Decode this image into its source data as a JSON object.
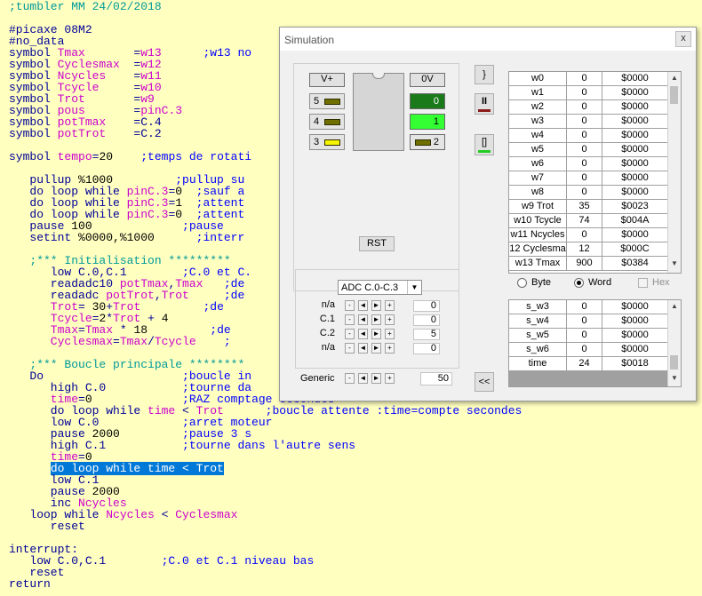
{
  "code_lines": [
    [
      {
        "c": "gr",
        "t": ";tumbler MM 24/02/2018"
      }
    ],
    [],
    [
      {
        "c": "kw",
        "t": "#picaxe 08M2"
      }
    ],
    [
      {
        "c": "kw",
        "t": "#no_data"
      }
    ],
    [
      {
        "c": "kw",
        "t": "symbol "
      },
      {
        "c": "vr",
        "t": "Tmax"
      },
      {
        "c": "kw",
        "t": "       ="
      },
      {
        "c": "vr",
        "t": "w13"
      },
      {
        "c": "cm",
        "t": "      ;w13 no"
      }
    ],
    [
      {
        "c": "kw",
        "t": "symbol "
      },
      {
        "c": "vr",
        "t": "Cyclesmax"
      },
      {
        "c": "kw",
        "t": "  ="
      },
      {
        "c": "vr",
        "t": "w12"
      }
    ],
    [
      {
        "c": "kw",
        "t": "symbol "
      },
      {
        "c": "vr",
        "t": "Ncycles"
      },
      {
        "c": "kw",
        "t": "    ="
      },
      {
        "c": "vr",
        "t": "w11"
      }
    ],
    [
      {
        "c": "kw",
        "t": "symbol "
      },
      {
        "c": "vr",
        "t": "Tcycle"
      },
      {
        "c": "kw",
        "t": "     ="
      },
      {
        "c": "vr",
        "t": "w10"
      }
    ],
    [
      {
        "c": "kw",
        "t": "symbol "
      },
      {
        "c": "vr",
        "t": "Trot"
      },
      {
        "c": "kw",
        "t": "       ="
      },
      {
        "c": "vr",
        "t": "w9"
      }
    ],
    [
      {
        "c": "kw",
        "t": "symbol "
      },
      {
        "c": "vr",
        "t": "pous"
      },
      {
        "c": "kw",
        "t": "       ="
      },
      {
        "c": "vr",
        "t": "pinC.3"
      }
    ],
    [
      {
        "c": "kw",
        "t": "symbol "
      },
      {
        "c": "vr",
        "t": "potTmax"
      },
      {
        "c": "kw",
        "t": "    =C.4"
      }
    ],
    [
      {
        "c": "kw",
        "t": "symbol "
      },
      {
        "c": "vr",
        "t": "potTrot"
      },
      {
        "c": "kw",
        "t": "    =C.2"
      }
    ],
    [],
    [
      {
        "c": "kw",
        "t": "symbol "
      },
      {
        "c": "vr",
        "t": "tempo"
      },
      {
        "c": "kw",
        "t": "="
      },
      {
        "c": "nm",
        "t": "20"
      },
      {
        "c": "cm",
        "t": "    ;temps de rotati"
      }
    ],
    [],
    [
      {
        "c": "kw",
        "t": "   pullup "
      },
      {
        "c": "nm",
        "t": "%1000"
      },
      {
        "c": "cm",
        "t": "         ;pullup su"
      }
    ],
    [
      {
        "c": "kw",
        "t": "   do loop while "
      },
      {
        "c": "vr",
        "t": "pinC.3"
      },
      {
        "c": "kw",
        "t": "="
      },
      {
        "c": "nm",
        "t": "0"
      },
      {
        "c": "cm",
        "t": "  ;sauf a"
      }
    ],
    [
      {
        "c": "kw",
        "t": "   do loop while "
      },
      {
        "c": "vr",
        "t": "pinC.3"
      },
      {
        "c": "kw",
        "t": "="
      },
      {
        "c": "nm",
        "t": "1"
      },
      {
        "c": "cm",
        "t": "  ;attent"
      }
    ],
    [
      {
        "c": "kw",
        "t": "   do loop while "
      },
      {
        "c": "vr",
        "t": "pinC.3"
      },
      {
        "c": "kw",
        "t": "="
      },
      {
        "c": "nm",
        "t": "0"
      },
      {
        "c": "cm",
        "t": "  ;attent"
      }
    ],
    [
      {
        "c": "kw",
        "t": "   pause "
      },
      {
        "c": "nm",
        "t": "100"
      },
      {
        "c": "cm",
        "t": "             ;pause"
      }
    ],
    [
      {
        "c": "kw",
        "t": "   setint "
      },
      {
        "c": "nm",
        "t": "%0000,%1000"
      },
      {
        "c": "cm",
        "t": "      ;interr"
      }
    ],
    [],
    [
      {
        "c": "gr",
        "t": "   ;*** Initialisation *********"
      }
    ],
    [
      {
        "c": "kw",
        "t": "      low C.0,C.1"
      },
      {
        "c": "cm",
        "t": "        ;C.0 et C."
      }
    ],
    [
      {
        "c": "kw",
        "t": "      readadc10 "
      },
      {
        "c": "vr",
        "t": "potTmax"
      },
      {
        "c": "kw",
        "t": ","
      },
      {
        "c": "vr",
        "t": "Tmax"
      },
      {
        "c": "cm",
        "t": "   ;de"
      }
    ],
    [
      {
        "c": "kw",
        "t": "      readadc "
      },
      {
        "c": "vr",
        "t": "potTrot"
      },
      {
        "c": "kw",
        "t": ","
      },
      {
        "c": "vr",
        "t": "Trot"
      },
      {
        "c": "cm",
        "t": "     ;de"
      }
    ],
    [
      {
        "c": "vr",
        "t": "      Trot"
      },
      {
        "c": "kw",
        "t": "= "
      },
      {
        "c": "nm",
        "t": "30"
      },
      {
        "c": "kw",
        "t": "+"
      },
      {
        "c": "vr",
        "t": "Trot"
      },
      {
        "c": "cm",
        "t": "         ;de"
      }
    ],
    [
      {
        "c": "vr",
        "t": "      Tcycle"
      },
      {
        "c": "kw",
        "t": "="
      },
      {
        "c": "nm",
        "t": "2"
      },
      {
        "c": "kw",
        "t": "*"
      },
      {
        "c": "vr",
        "t": "Trot"
      },
      {
        "c": "kw",
        "t": " + "
      },
      {
        "c": "nm",
        "t": "4"
      }
    ],
    [
      {
        "c": "vr",
        "t": "      Tmax"
      },
      {
        "c": "kw",
        "t": "="
      },
      {
        "c": "vr",
        "t": "Tmax"
      },
      {
        "c": "kw",
        "t": " * "
      },
      {
        "c": "nm",
        "t": "18"
      },
      {
        "c": "cm",
        "t": "         ;de"
      }
    ],
    [
      {
        "c": "vr",
        "t": "      Cyclesmax"
      },
      {
        "c": "kw",
        "t": "="
      },
      {
        "c": "vr",
        "t": "Tmax"
      },
      {
        "c": "kw",
        "t": "/"
      },
      {
        "c": "vr",
        "t": "Tcycle"
      },
      {
        "c": "cm",
        "t": "    ;"
      }
    ],
    [],
    [
      {
        "c": "gr",
        "t": "   ;*** Boucle principale ********"
      }
    ],
    [
      {
        "c": "kw",
        "t": "   Do"
      },
      {
        "c": "cm",
        "t": "                    ;boucle in"
      }
    ],
    [
      {
        "c": "kw",
        "t": "      high C.0"
      },
      {
        "c": "cm",
        "t": "           ;tourne da"
      }
    ],
    [
      {
        "c": "vr",
        "t": "      time"
      },
      {
        "c": "kw",
        "t": "="
      },
      {
        "c": "nm",
        "t": "0"
      },
      {
        "c": "cm",
        "t": "             ;RAZ comptage secondes"
      }
    ],
    [
      {
        "c": "kw",
        "t": "      do loop while "
      },
      {
        "c": "vr",
        "t": "time"
      },
      {
        "c": "kw",
        "t": " < "
      },
      {
        "c": "vr",
        "t": "Trot"
      },
      {
        "c": "cm",
        "t": "      ;boucle attente :time=compte secondes"
      }
    ],
    [
      {
        "c": "kw",
        "t": "      low C.0"
      },
      {
        "c": "cm",
        "t": "            ;arret moteur"
      }
    ],
    [
      {
        "c": "kw",
        "t": "      pause "
      },
      {
        "c": "nm",
        "t": "2000"
      },
      {
        "c": "cm",
        "t": "         ;pause 3 s"
      }
    ],
    [
      {
        "c": "kw",
        "t": "      high C.1"
      },
      {
        "c": "cm",
        "t": "           ;tourne dans l'autre sens"
      }
    ],
    [
      {
        "c": "vr",
        "t": "      time"
      },
      {
        "c": "kw",
        "t": "="
      },
      {
        "c": "nm",
        "t": "0"
      }
    ],
    [
      {
        "c": "kw",
        "t": "      "
      },
      {
        "c": "sel",
        "t": "do loop while time < Trot"
      }
    ],
    [
      {
        "c": "kw",
        "t": "      low C.1"
      }
    ],
    [
      {
        "c": "kw",
        "t": "      pause "
      },
      {
        "c": "nm",
        "t": "2000"
      }
    ],
    [
      {
        "c": "kw",
        "t": "      inc "
      },
      {
        "c": "vr",
        "t": "Ncycles"
      }
    ],
    [
      {
        "c": "kw",
        "t": "   loop while "
      },
      {
        "c": "vr",
        "t": "Ncycles"
      },
      {
        "c": "kw",
        "t": " < "
      },
      {
        "c": "vr",
        "t": "Cyclesmax"
      }
    ],
    [
      {
        "c": "kw",
        "t": "      reset"
      }
    ],
    [],
    [
      {
        "c": "kw",
        "t": "interrupt:"
      }
    ],
    [
      {
        "c": "kw",
        "t": "   low C.0,C.1"
      },
      {
        "c": "cm",
        "t": "        ;C.0 et C.1 niveau bas"
      }
    ],
    [
      {
        "c": "kw",
        "t": "   reset"
      }
    ],
    [
      {
        "c": "kw",
        "t": "return"
      }
    ]
  ],
  "sim": {
    "title": "Simulation",
    "close": "x",
    "vplus": "V+",
    "zerov": "0V",
    "pins_left": [
      {
        "label": "5",
        "led": "off"
      },
      {
        "label": "4",
        "led": "off"
      },
      {
        "label": "3",
        "led": "on"
      }
    ],
    "pins_right": [
      {
        "label": "0",
        "color": "#1a7a1a"
      },
      {
        "label": "1",
        "color": "#33ff33"
      },
      {
        "label": "2",
        "color": "#e4e4e4"
      }
    ],
    "rst": "RST",
    "adc_select": "ADC C.0-C.3",
    "adc_rows": [
      {
        "label": "n/a",
        "value": "0"
      },
      {
        "label": "C.1",
        "value": "0"
      },
      {
        "label": "C.2",
        "value": "5"
      },
      {
        "label": "n/a",
        "value": "0"
      }
    ],
    "generic_label": "Generic",
    "generic_value": "50",
    "ctrl": {
      "step": "}",
      "pause": "II",
      "stop": "[]",
      "back": "<<"
    },
    "vars": [
      {
        "n": "w0",
        "d": "0",
        "h": "$0000"
      },
      {
        "n": "w1",
        "d": "0",
        "h": "$0000"
      },
      {
        "n": "w2",
        "d": "0",
        "h": "$0000"
      },
      {
        "n": "w3",
        "d": "0",
        "h": "$0000"
      },
      {
        "n": "w4",
        "d": "0",
        "h": "$0000"
      },
      {
        "n": "w5",
        "d": "0",
        "h": "$0000"
      },
      {
        "n": "w6",
        "d": "0",
        "h": "$0000"
      },
      {
        "n": "w7",
        "d": "0",
        "h": "$0000"
      },
      {
        "n": "w8",
        "d": "0",
        "h": "$0000"
      },
      {
        "n": "w9 Trot",
        "d": "35",
        "h": "$0023"
      },
      {
        "n": "w10 Tcycle",
        "d": "74",
        "h": "$004A"
      },
      {
        "n": "w11 Ncycles",
        "d": "0",
        "h": "$0000"
      },
      {
        "n": "12 Cyclesma",
        "d": "12",
        "h": "$000C"
      },
      {
        "n": "w13 Tmax",
        "d": "900",
        "h": "$0384"
      }
    ],
    "radio_byte": "Byte",
    "radio_word": "Word",
    "check_hex": "Hex",
    "sys": [
      {
        "n": "s_w3",
        "d": "0",
        "h": "$0000"
      },
      {
        "n": "s_w4",
        "d": "0",
        "h": "$0000"
      },
      {
        "n": "s_w5",
        "d": "0",
        "h": "$0000"
      },
      {
        "n": "s_w6",
        "d": "0",
        "h": "$0000"
      },
      {
        "n": "time",
        "d": "24",
        "h": "$0018"
      }
    ]
  }
}
